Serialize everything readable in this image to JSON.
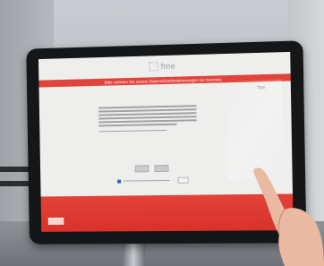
{
  "screen": {
    "brand": "fme",
    "banner_text": "Bitte nehmen Sie unsere Datenschutzbestimmungen zur Kenntnis",
    "mini_brand": "fme",
    "colors": {
      "accent_red": "#e0443a",
      "screen_bg": "#eeeeed",
      "checkbox_blue": "#2c61c8"
    }
  }
}
